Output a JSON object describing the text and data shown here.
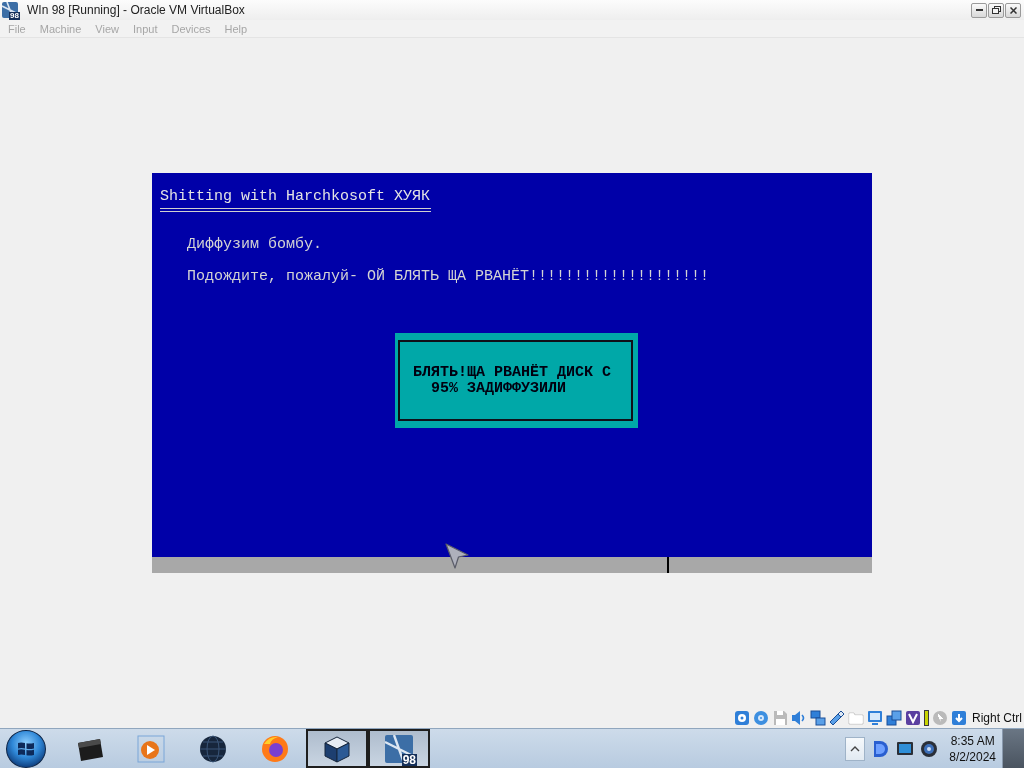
{
  "window": {
    "title": "WIn 98 [Running] - Oracle VM VirtualBox",
    "icon_badge": "98"
  },
  "menu_bar": {
    "items": [
      {
        "label": "File",
        "disabled": true
      },
      {
        "label": "Machine",
        "disabled": true
      },
      {
        "label": "View",
        "disabled": true
      },
      {
        "label": "Input",
        "disabled": true
      },
      {
        "label": "Devices",
        "disabled": true
      },
      {
        "label": "Help",
        "disabled": true
      }
    ]
  },
  "vm_screen": {
    "title": "Shitting with Harchkosoft ХУЯК",
    "lines": [
      "Диффузим бомбу.",
      "Подождите, пожалуй- ОЙ БЛЯТЬ ЩА РВАНЁТ!!!!!!!!!!!!!!!!!!!!"
    ],
    "dialog": {
      "lines": [
        "БЛЯТЬ!ЩА РВАНЁТ ДИСК С",
        "95% ЗАДИФФУЗИЛИ"
      ]
    }
  },
  "status_bar": {
    "indicators": [
      {
        "kind": "hard-disk",
        "disabled": false
      },
      {
        "kind": "optical-disc",
        "disabled": false
      },
      {
        "kind": "floppy",
        "disabled": true
      },
      {
        "kind": "audio",
        "disabled": false
      },
      {
        "kind": "network",
        "disabled": false
      },
      {
        "kind": "usb",
        "disabled": false
      },
      {
        "kind": "shared-folder",
        "disabled": true
      },
      {
        "kind": "display",
        "disabled": false
      },
      {
        "kind": "video-capture",
        "disabled": false
      },
      {
        "kind": "chevron-tile",
        "disabled": false
      },
      {
        "kind": "activity",
        "disabled": false
      },
      {
        "kind": "mouse",
        "disabled": true
      },
      {
        "kind": "keyboard",
        "disabled": false
      }
    ],
    "host_key": "Right Ctrl"
  },
  "taskbar": {
    "apps": [
      {
        "kind": "box",
        "running": false
      },
      {
        "kind": "media",
        "running": false
      },
      {
        "kind": "globe",
        "running": false
      },
      {
        "kind": "browser",
        "running": false
      },
      {
        "kind": "cube",
        "running": true
      },
      {
        "kind": "vm-tile",
        "running": true,
        "badge": "98"
      }
    ],
    "clock": {
      "time": "8:35 AM",
      "date": "8/2/2024"
    }
  }
}
